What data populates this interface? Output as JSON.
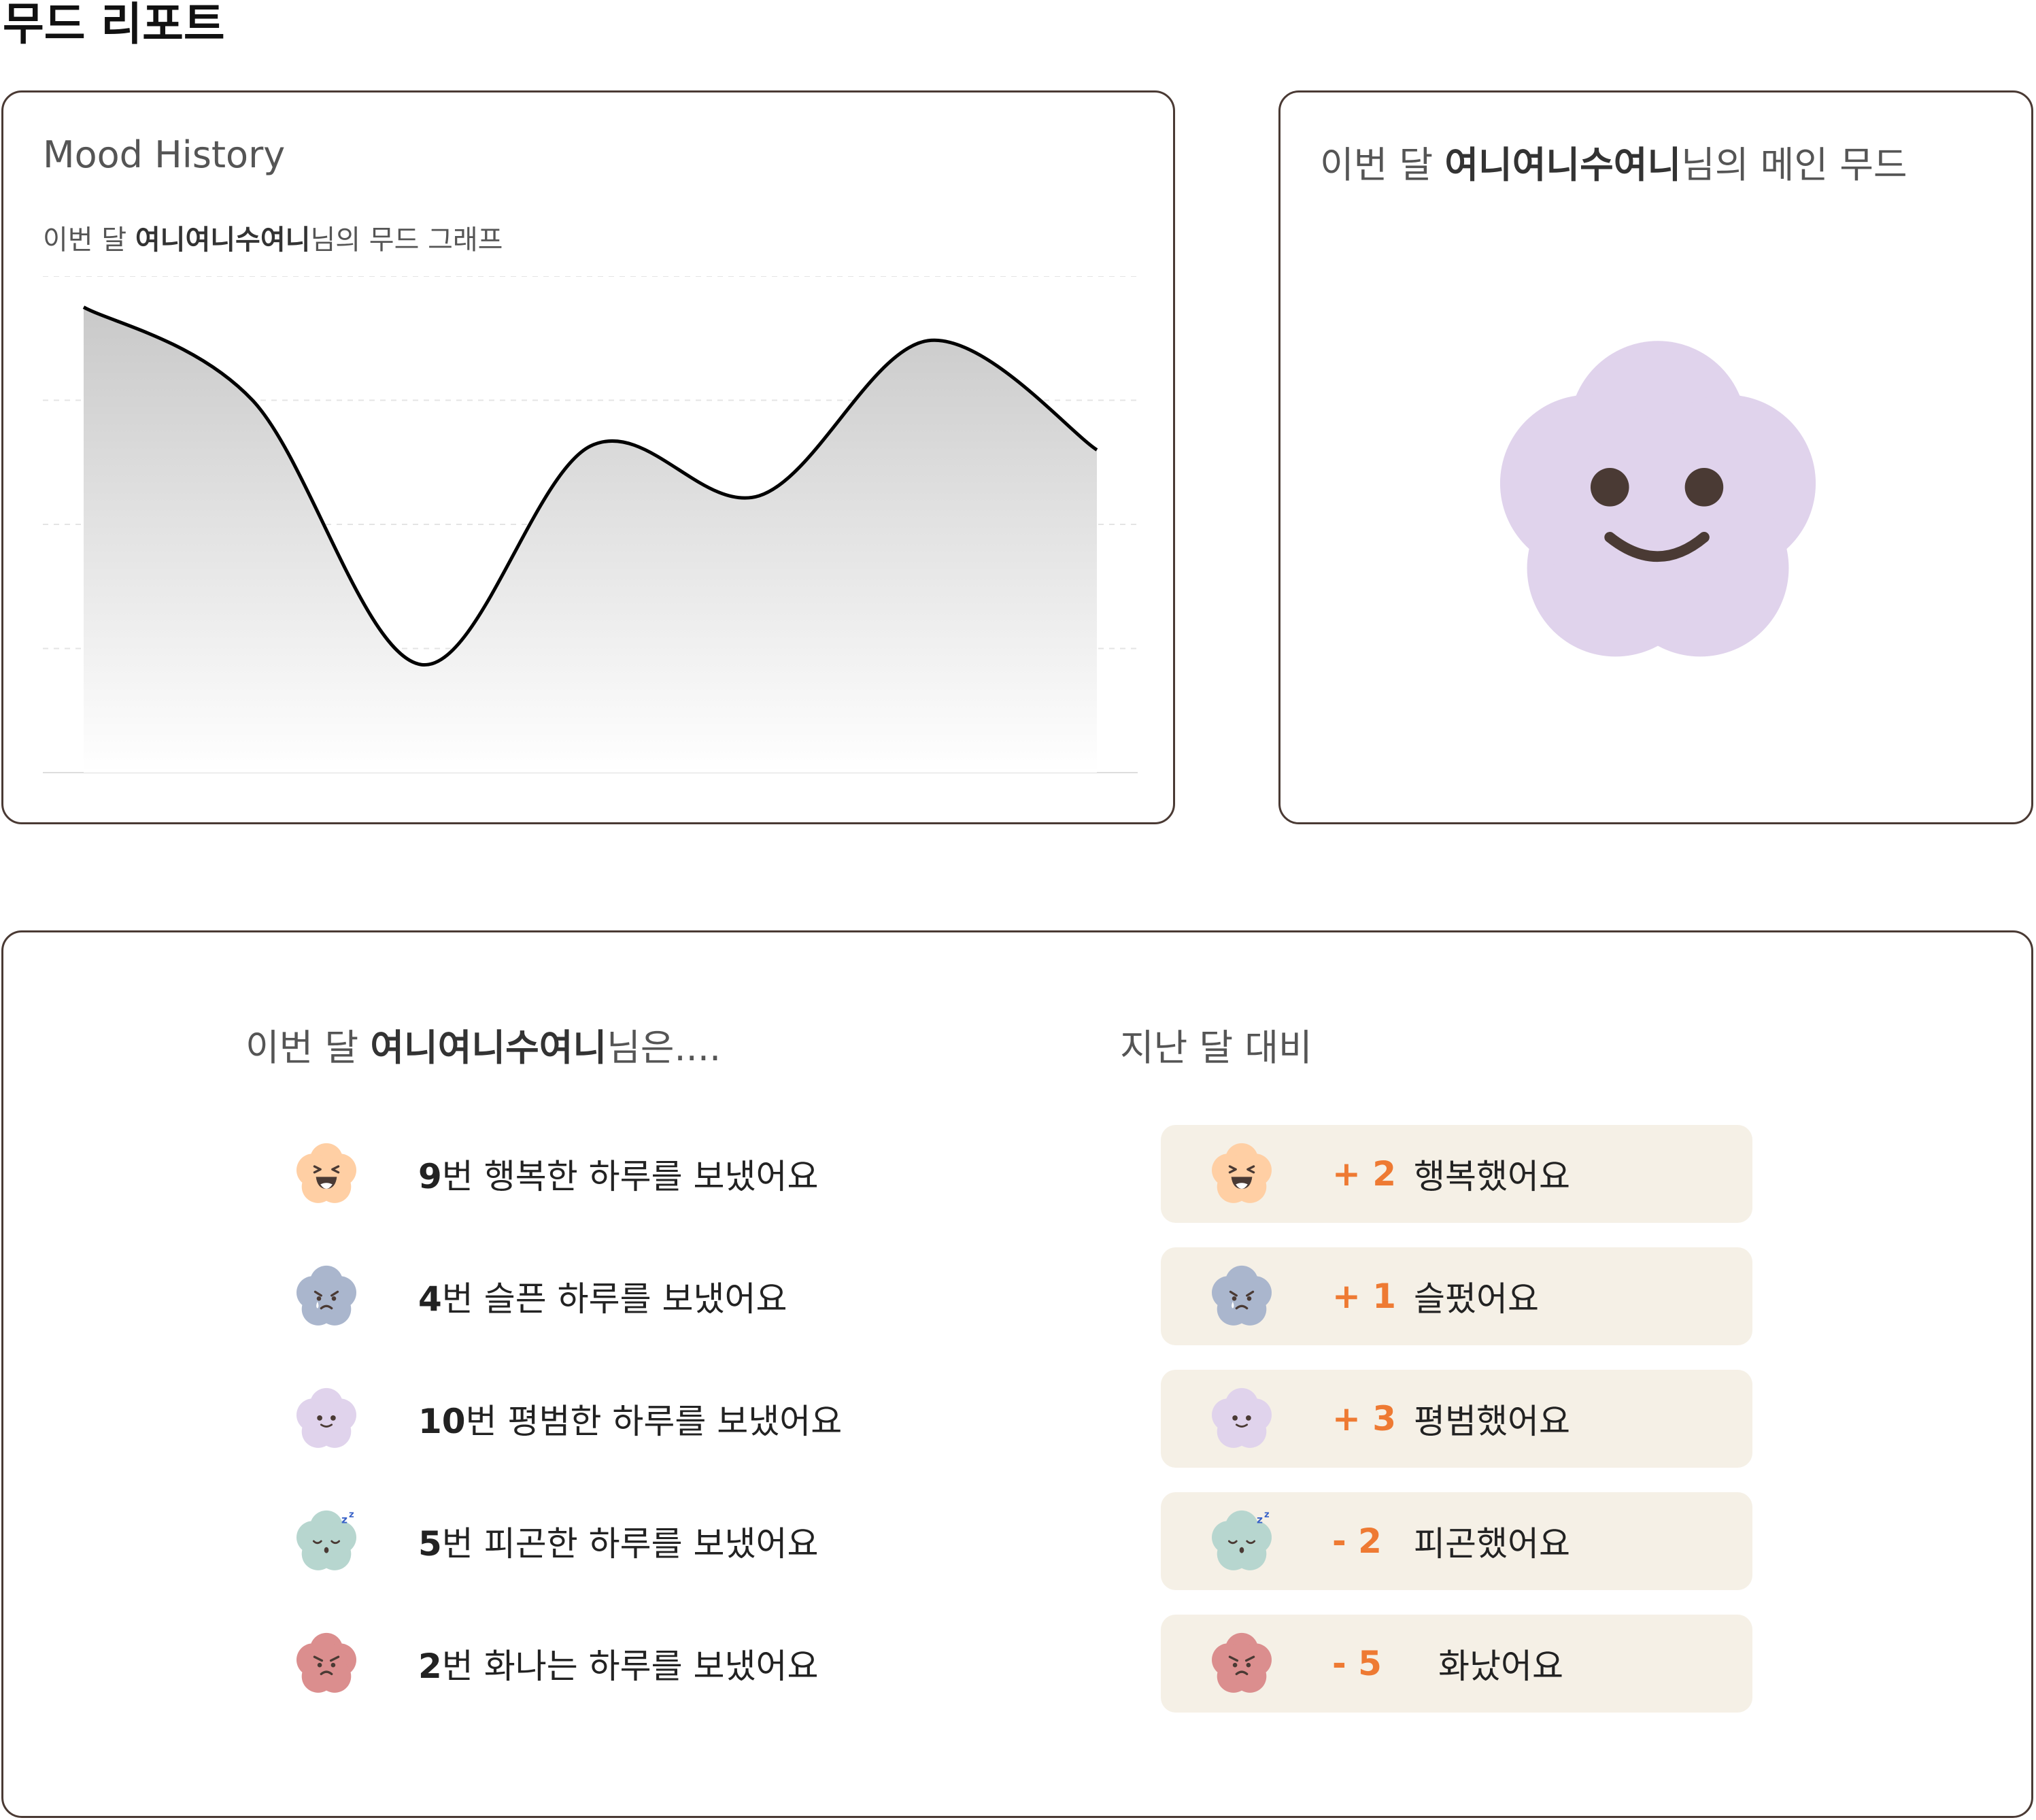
{
  "page": {
    "title": "무드 리포트"
  },
  "history": {
    "heading": "Mood History",
    "sub_prefix": "이번 달 ",
    "user_name": "여니여니수여니",
    "sub_suffix": "님의 무드 그래프"
  },
  "main_mood": {
    "prefix": "이번 달 ",
    "user_name": "여니여니수여니",
    "suffix": "님의 메인 무드",
    "mood": "neutral",
    "color": "#e0d3ec"
  },
  "summary": {
    "this_month_prefix": "이번 달 ",
    "user_name": "여니여니수여니",
    "this_month_suffix": "님은....",
    "compare_heading": "지난 달 대비",
    "counts": [
      {
        "count": "9",
        "text": "번 행복한 하루를 보냈어요",
        "mood": "happy"
      },
      {
        "count": "4",
        "text": "번 슬픈 하루를 보냈어요",
        "mood": "sad"
      },
      {
        "count": "10",
        "text": "번 평범한 하루를 보냈어요",
        "mood": "neutral"
      },
      {
        "count": "5",
        "text": "번 피곤한 하루를 보냈어요",
        "mood": "tired"
      },
      {
        "count": "2",
        "text": "번 화나는 하루를 보냈어요",
        "mood": "angry"
      }
    ],
    "comparisons": [
      {
        "delta": "+ 2",
        "label": "행복했어요",
        "mood": "happy"
      },
      {
        "delta": "+ 1",
        "label": "슬펐어요",
        "mood": "sad"
      },
      {
        "delta": "+ 3",
        "label": "평범했어요",
        "mood": "neutral"
      },
      {
        "delta": "- 2",
        "label": "피곤했어요",
        "mood": "tired"
      },
      {
        "delta": "- 5",
        "label": "화났어요",
        "mood": "angry"
      }
    ]
  },
  "mood_colors": {
    "happy": "#ffcfa4",
    "sad": "#aab6cd",
    "neutral": "#e0d3ec",
    "tired": "#b7d6cf",
    "angry": "#db8e8e"
  },
  "accent_color": "#ee7a33",
  "chart_data": {
    "type": "area",
    "title": "",
    "xlabel": "",
    "ylabel": "",
    "ylim": [
      0,
      4
    ],
    "grid": true,
    "x": [
      1,
      2,
      3,
      4,
      5,
      6,
      7
    ],
    "values": [
      3.75,
      3.0,
      0.87,
      2.63,
      2.23,
      3.48,
      2.6
    ]
  }
}
